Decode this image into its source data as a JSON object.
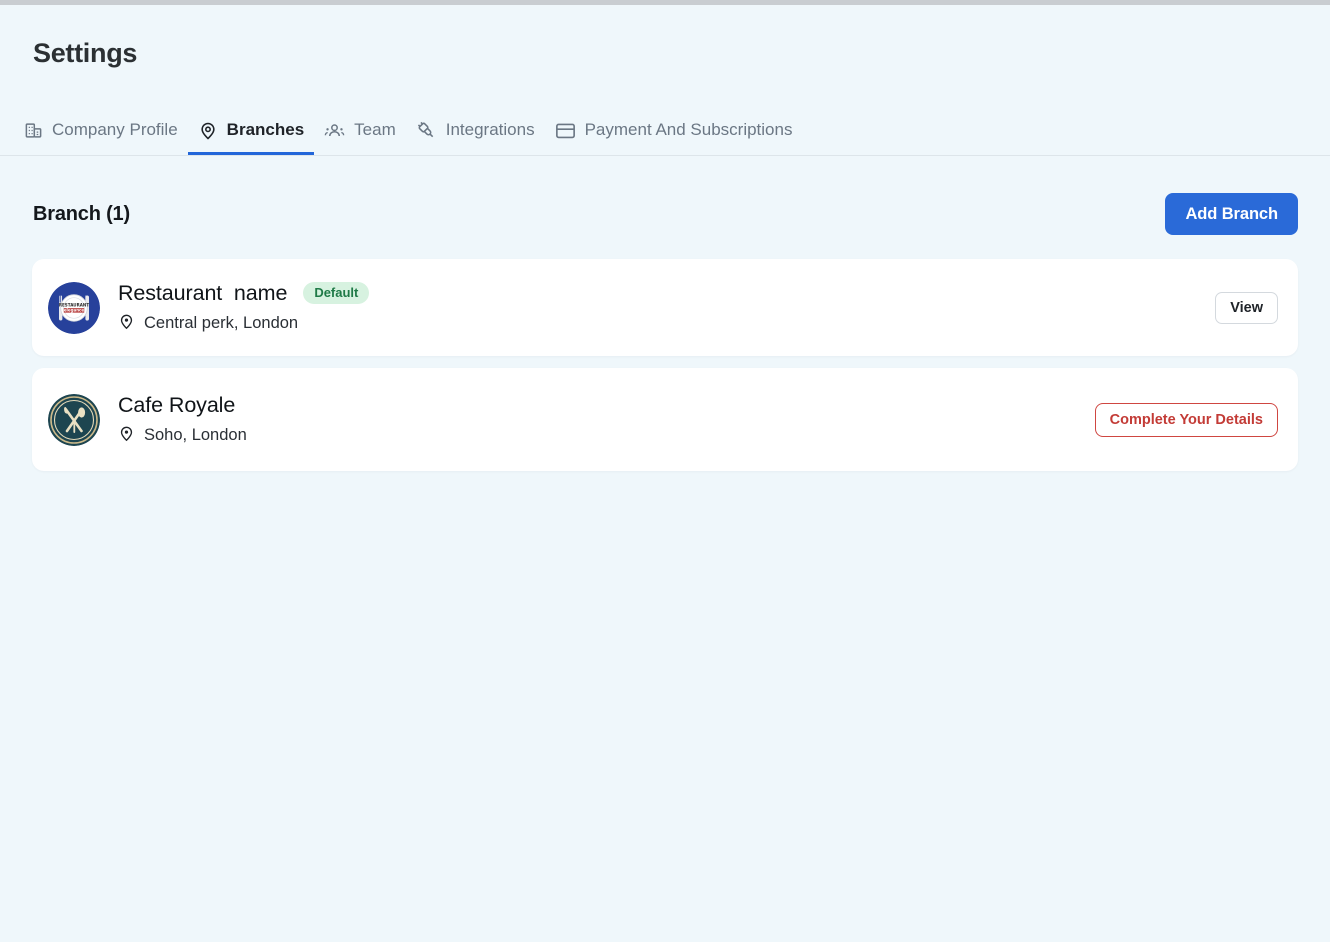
{
  "colors": {
    "background": "#eff7fb",
    "accent": "#2a6ad8",
    "card": "#ffffff",
    "badge_bg": "#d7f2e0",
    "badge_text": "#1f7a47",
    "danger": "#c33b36"
  },
  "header": {
    "title": "Settings"
  },
  "tabs": [
    {
      "label": "Company Profile",
      "icon": "building-icon",
      "active": false
    },
    {
      "label": "Branches",
      "icon": "location-pin-icon",
      "active": true
    },
    {
      "label": "Team",
      "icon": "people-icon",
      "active": false
    },
    {
      "label": "Integrations",
      "icon": "plug-icon",
      "active": false
    },
    {
      "label": "Payment And Subscriptions",
      "icon": "credit-card-icon",
      "active": false
    }
  ],
  "section": {
    "title": "Branch (1)",
    "add_branch_label": "Add Branch"
  },
  "branches": [
    {
      "name": "Restaurant  name",
      "address": "Central perk, London",
      "badge": "Default",
      "action_label": "View",
      "action_type": "view",
      "logo": "restaurant-plate-logo"
    },
    {
      "name": "Cafe Royale",
      "address": "Soho, London",
      "badge": null,
      "action_label": "Complete Your Details",
      "action_type": "complete",
      "logo": "cafe-royale-cutlery-logo"
    }
  ]
}
